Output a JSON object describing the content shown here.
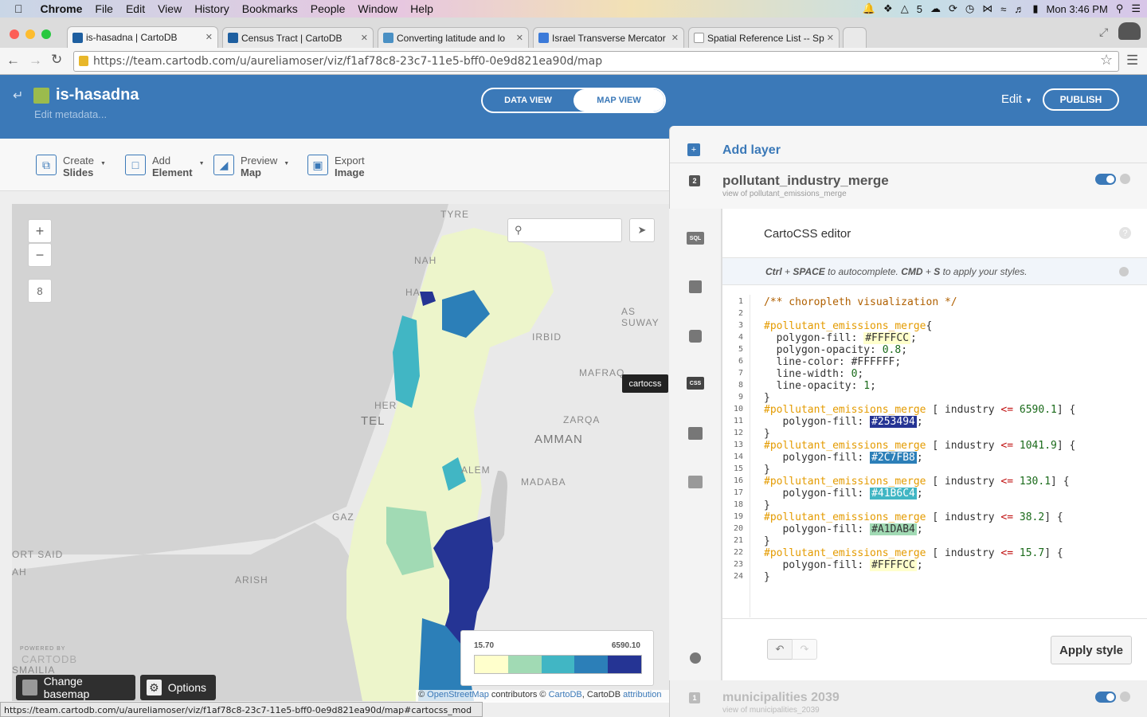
{
  "menubar": {
    "app": "Chrome",
    "items": [
      "File",
      "Edit",
      "View",
      "History",
      "Bookmarks",
      "People",
      "Window",
      "Help"
    ],
    "status_badge": "5",
    "clock": "Mon 3:46 PM"
  },
  "tabs": [
    {
      "title": "is-hasadna | CartoDB",
      "active": true,
      "favicon_color": "#1e5fa0"
    },
    {
      "title": "Census Tract | CartoDB",
      "active": false,
      "favicon_color": "#1e5fa0"
    },
    {
      "title": "Converting latitude and lo",
      "active": false,
      "favicon_color": "#4a90c4"
    },
    {
      "title": "Israel Transverse Mercator",
      "active": false,
      "favicon_color": "#3b7ad9"
    },
    {
      "title": "Spatial Reference List -- Sp",
      "active": false,
      "favicon_color": "#999999"
    }
  ],
  "url": "https://team.cartodb.com/u/aureliamoser/viz/f1af78c8-23c7-11e5-bff0-0e9d821ea90d/map",
  "header": {
    "title": "is-hasadna",
    "subtitle": "Edit metadata...",
    "data_view": "DATA VIEW",
    "map_view": "MAP VIEW",
    "edit": "Edit",
    "publish": "PUBLISH"
  },
  "map_toolbar": [
    {
      "line1": "Create",
      "line2": "Slides",
      "icon": "slides-icon",
      "caret": true
    },
    {
      "line1": "Add",
      "line2": "Element",
      "icon": "element-icon",
      "caret": true
    },
    {
      "line1": "Preview",
      "line2": "Map",
      "icon": "preview-icon",
      "caret": true
    },
    {
      "line1": "Export",
      "line2": "Image",
      "icon": "image-icon",
      "caret": false
    }
  ],
  "map": {
    "zoom_in": "+",
    "zoom_out": "−",
    "zoom_level": "8",
    "search_placeholder": "",
    "places": [
      "TYRE",
      "NAH",
      "HA",
      "AS SUWAY",
      "IRBID",
      "MAFRAQ",
      "ZARQA",
      "HER",
      "TEL",
      "AMMAN",
      "ALEM",
      "MADABA",
      "GAZ",
      "ORT SAID",
      "AH",
      "ARISH",
      "SMAILIA"
    ],
    "powered_by": "POWERED BY",
    "cartodb_mark": "CARTODB",
    "legend": {
      "min": "15.70",
      "max": "6590.10",
      "colors": [
        "#FFFFCC",
        "#A1DAB4",
        "#41B6C4",
        "#2C7FB8",
        "#253494"
      ]
    },
    "change_basemap": "Change basemap",
    "options": "Options",
    "attribution": {
      "prefix": "©",
      "osm": "OpenStreetMap",
      "mid": "contributors ©",
      "cartodb": "CartoDB",
      "sep": ", CartoDB",
      "attr": "attribution"
    }
  },
  "status_url": "https://team.cartodb.com/u/aureliamoser/viz/f1af78c8-23c7-11e5-bff0-0e9d821ea90d/map#cartocss_mod",
  "panel": {
    "add_layer": "Add layer",
    "layer2": {
      "num": "2",
      "name": "pollutant_industry_merge",
      "sub": "view of pollutant_emissions_merge"
    },
    "layer1": {
      "num": "1",
      "name": "municipalities 2039",
      "sub": "view of municipalities_2039"
    },
    "tooltip": "cartocss",
    "side_icons": [
      "SQL",
      "wizard",
      "infowindow",
      "CSS",
      "legend",
      "chart"
    ],
    "editor_title": "CartoCSS editor",
    "hint": {
      "k1": "Ctrl",
      "plus1": " + ",
      "k2": "SPACE",
      "t1": " to autocomplete. ",
      "k3": "CMD",
      "plus2": " + ",
      "k4": "S",
      "t2": " to apply your styles."
    },
    "apply_style": "Apply style"
  },
  "code_lines": [
    "/** choropleth visualization */",
    "",
    "#pollutant_emissions_merge{",
    "  polygon-fill: #FFFFCC;",
    "  polygon-opacity: 0.8;",
    "  line-color: #FFFFFF;",
    "  line-width: 0;",
    "  line-opacity: 1;",
    "}",
    "#pollutant_emissions_merge [ industry <= 6590.1] {",
    "   polygon-fill: #253494;",
    "}",
    "#pollutant_emissions_merge [ industry <= 1041.9] {",
    "   polygon-fill: #2C7FB8;",
    "}",
    "#pollutant_emissions_merge [ industry <= 130.1] {",
    "   polygon-fill: #41B6C4;",
    "}",
    "#pollutant_emissions_merge [ industry <= 38.2] {",
    "   polygon-fill: #A1DAB4;",
    "}",
    "#pollutant_emissions_merge [ industry <= 15.7] {",
    "   polygon-fill: #FFFFCC;",
    "}"
  ],
  "colors": {
    "brand": "#3b79b8",
    "dark_blue": "#253494",
    "mid_blue": "#2C7FB8",
    "teal": "#41B6C4",
    "green": "#A1DAB4",
    "cream": "#FFFFCC"
  }
}
